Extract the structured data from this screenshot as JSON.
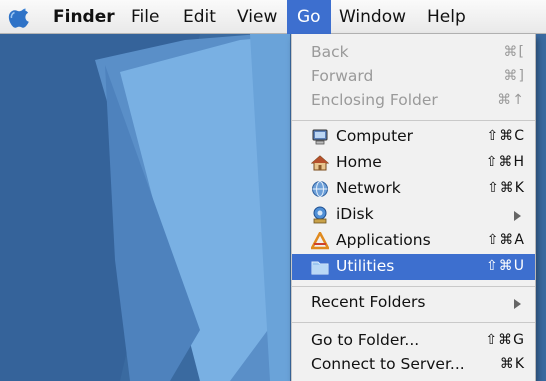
{
  "menubar": {
    "apple_icon": "apple-icon",
    "items": [
      "Finder",
      "File",
      "Edit",
      "View",
      "Go",
      "Window",
      "Help"
    ],
    "active": "Go"
  },
  "go_menu": {
    "back": {
      "label": "Back",
      "shortcut": "⌘["
    },
    "forward": {
      "label": "Forward",
      "shortcut": "⌘]"
    },
    "enclosing": {
      "label": "Enclosing Folder",
      "shortcut": "⌘↑"
    },
    "computer": {
      "label": "Computer",
      "shortcut": "⇧⌘C",
      "icon": "computer-icon"
    },
    "home": {
      "label": "Home",
      "shortcut": "⇧⌘H",
      "icon": "home-icon"
    },
    "network": {
      "label": "Network",
      "shortcut": "⇧⌘K",
      "icon": "network-icon"
    },
    "idisk": {
      "label": "iDisk",
      "icon": "idisk-icon"
    },
    "applications": {
      "label": "Applications",
      "shortcut": "⇧⌘A",
      "icon": "applications-icon"
    },
    "utilities": {
      "label": "Utilities",
      "shortcut": "⇧⌘U",
      "icon": "utilities-folder-icon"
    },
    "recent": {
      "label": "Recent Folders"
    },
    "goto": {
      "label": "Go to Folder...",
      "shortcut": "⇧⌘G"
    },
    "connect": {
      "label": "Connect to Server...",
      "shortcut": "⌘K"
    }
  },
  "colors": {
    "highlight": "#3d6fcf",
    "desktop": "#3b6ea3"
  }
}
